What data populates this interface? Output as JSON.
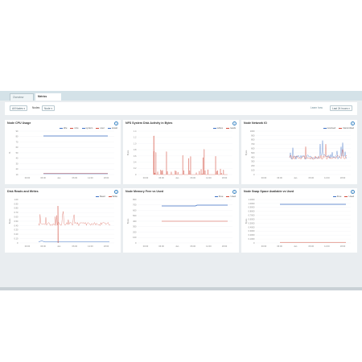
{
  "tabs": [
    {
      "label": "Overview"
    },
    {
      "label": "Metrics"
    }
  ],
  "toolbar": {
    "all_nodes_label": "All Nodes ▾",
    "scope_label": "Nodes",
    "scope_value": "Node ▾",
    "about_link": "Learn how",
    "refresh_label": "Last 24 hours ▾"
  },
  "panels": [
    {
      "id": "cpu",
      "title": "Node CPU Usage",
      "legend": [
        "idle",
        "nice",
        "system",
        "user",
        "iowait"
      ],
      "ylabel": "%",
      "xticks": [
        "00:00",
        "06:00",
        "Jan",
        "06:00",
        "12:00",
        "18:00"
      ],
      "yticks": [
        "90",
        "80",
        "70",
        "60",
        "50",
        "40",
        "30",
        "20",
        "10"
      ]
    },
    {
      "id": "disk_io",
      "title": "NFS System Disk Activity in Bytes",
      "legend": [
        "writes",
        "reads"
      ],
      "ylabel": "Bytes",
      "xticks": [
        "00:00",
        "06:00",
        "Jan",
        "06:00",
        "12:00",
        "18:00"
      ],
      "yticks": [
        "1.4",
        "1.2",
        "1.0",
        "0.8",
        "0.6",
        "0.4",
        "0.2",
        "0"
      ]
    },
    {
      "id": "net",
      "title": "Node Network IO",
      "legend": [
        "received",
        "transmitted"
      ],
      "ylabel": "Bytes",
      "xticks": [
        "00:00",
        "06:00",
        "Jan",
        "06:00",
        "12:00",
        "18:00"
      ],
      "yticks": [
        "1000",
        "900",
        "800",
        "700",
        "600",
        "500",
        "400",
        "300",
        "200",
        "100",
        "0"
      ]
    },
    {
      "id": "disk_rw",
      "title": "Disk Reads and Writes",
      "legend": [
        "Read",
        "Write"
      ],
      "ylabel": "Bytes",
      "xticks": [
        "00:00",
        "06:00",
        "Jan",
        "06:00",
        "12:00",
        "18:00"
      ],
      "yticks": [
        "1.00",
        "0.90",
        "0.80",
        "0.70",
        "0.60",
        "0.50",
        "0.40",
        "0.30",
        "0.20",
        "0.10",
        "0"
      ]
    },
    {
      "id": "mem",
      "title": "Node Memory Free vs Used",
      "legend": [
        "Free",
        "Used"
      ],
      "ylabel": "Bytes",
      "xticks": [
        "00:00",
        "06:00",
        "Jan",
        "06:00",
        "12:00",
        "18:00"
      ],
      "yticks": [
        "800",
        "700",
        "600",
        "500",
        "400",
        "300",
        "200",
        "100",
        "0"
      ]
    },
    {
      "id": "swap",
      "title": "Node Swap Space Available vs Used",
      "legend": [
        "Free",
        "Used"
      ],
      "ylabel": "Bytes",
      "xticks": [
        "00:00",
        "06:00",
        "Jan",
        "06:00",
        "12:00",
        "18:00"
      ],
      "yticks": [
        "1.2000",
        "1.0000",
        "0.9000",
        "0.8000",
        "0.7000",
        "0.6000",
        "0.5000",
        "0.4000",
        "0.3000",
        "0.2000",
        "0.1000",
        "0"
      ]
    }
  ],
  "colors": {
    "blue": "#3b6fc4",
    "red": "#d24a3a",
    "accent": "#3c86c4"
  }
}
